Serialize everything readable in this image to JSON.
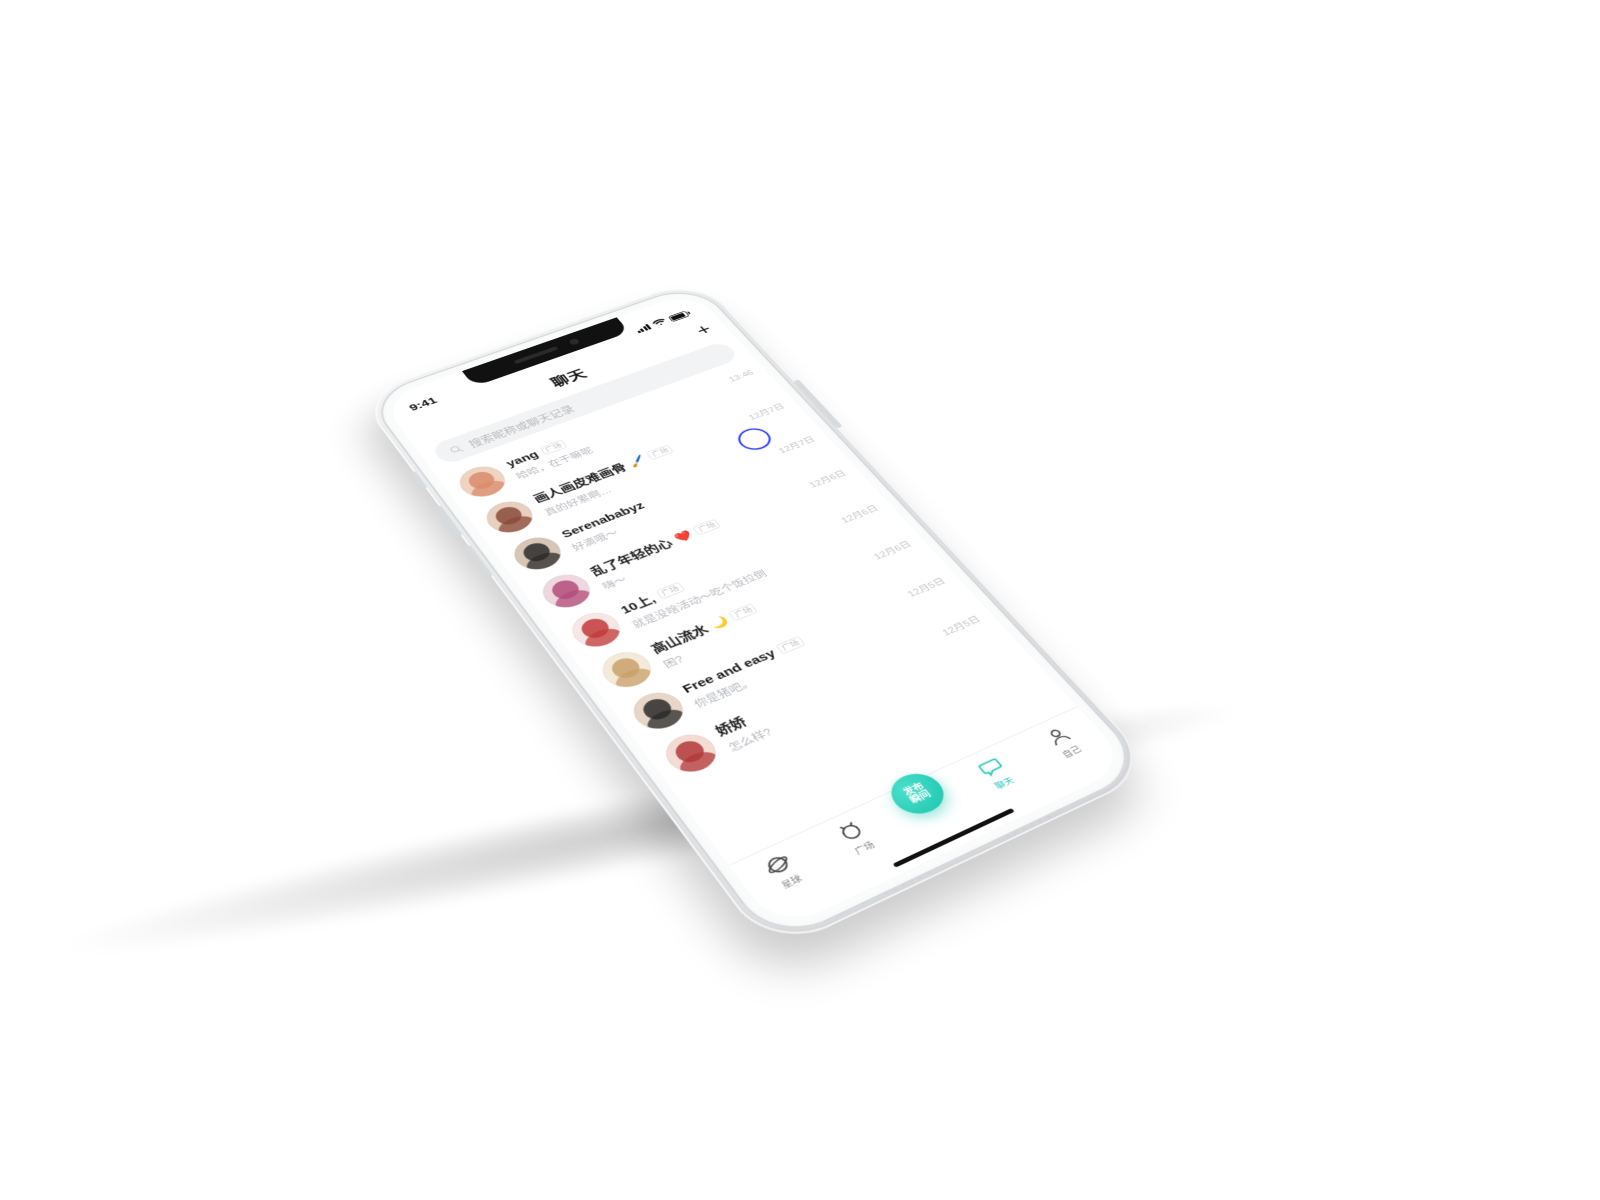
{
  "status": {
    "time": "9:41"
  },
  "header": {
    "title": "聊天",
    "add_label": "+"
  },
  "search": {
    "placeholder": "搜索昵称或聊天记录"
  },
  "chats": [
    {
      "name": "yang",
      "tag": "广场",
      "msg": "哈哈，在干嘛呢",
      "time": "13:46",
      "avatar": {
        "a": "#d98c6b",
        "b": "#f0d4c2"
      }
    },
    {
      "name": "画人画皮难画骨",
      "emoji": "🖌️",
      "tag": "广场",
      "msg": "真的好累啊…",
      "time": "12月7日",
      "avatar": {
        "a": "#8a4b3a",
        "b": "#e8d0c0"
      }
    },
    {
      "name": "Serenababyz",
      "tag": "",
      "msg": "好滴哦～",
      "time": "12月7日",
      "avatar": {
        "a": "#2c2a2a",
        "b": "#d7c6b6"
      }
    },
    {
      "name": "乱了年轻的心",
      "emoji": "❤️",
      "tag": "广场",
      "msg": "嗨～",
      "time": "12月6日",
      "avatar": {
        "a": "#b14c7a",
        "b": "#efd7e0"
      }
    },
    {
      "name": "10上,",
      "tag": "广场",
      "msg": "就是没啥活动～吃个饭拉倒",
      "time": "12月6日",
      "avatar": {
        "a": "#c23a3a",
        "b": "#f8e7e7"
      }
    },
    {
      "name": "高山流水",
      "emoji": "🌙",
      "tag": "广场",
      "msg": "困?",
      "time": "12月6日",
      "avatar": {
        "a": "#caa06a",
        "b": "#f3ead9"
      }
    },
    {
      "name": "Free and easy",
      "tag": "广场",
      "msg": "你是猪吧。",
      "time": "12月5日",
      "avatar": {
        "a": "#2a2a2a",
        "b": "#e8d6c8"
      }
    },
    {
      "name": "娇娇",
      "tag": "",
      "msg": "怎么样?",
      "time": "12月5日",
      "avatar": {
        "a": "#b23838",
        "b": "#f4dcd5"
      }
    }
  ],
  "tabs": {
    "planet": "星球",
    "square": "广场",
    "publish": "发布\n瞬间",
    "chat": "聊天",
    "self": "自己"
  },
  "colors": {
    "accent": "#28c9b7",
    "focus_ring": "#2a3bff"
  }
}
